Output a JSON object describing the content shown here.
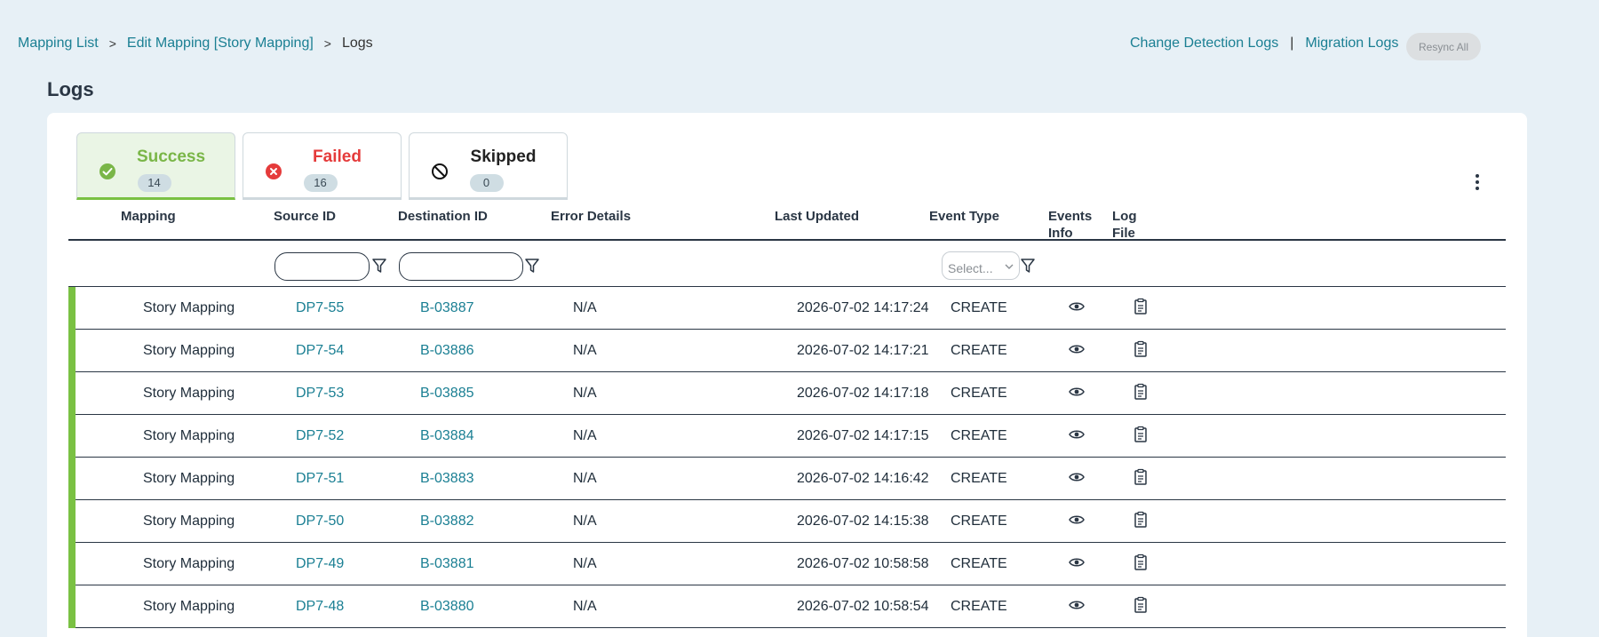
{
  "breadcrumb": {
    "items": [
      {
        "label": "Mapping List"
      },
      {
        "label": "Edit Mapping [Story Mapping]"
      },
      {
        "label": "Logs"
      }
    ],
    "separator": ">"
  },
  "toplinks": {
    "change_detection": "Change Detection Logs",
    "divider": "|",
    "migration": "Migration Logs",
    "resync": "Resync All"
  },
  "page_title": "Logs",
  "tabs": [
    {
      "label": "Success",
      "count": "14",
      "icon": "check-circle-icon",
      "color": "#7ab648"
    },
    {
      "label": "Failed",
      "count": "16",
      "icon": "x-circle-icon",
      "color": "#e53b3b"
    },
    {
      "label": "Skipped",
      "count": "0",
      "icon": "ban-icon",
      "color": "#222222"
    }
  ],
  "table": {
    "headers": {
      "mapping": "Mapping",
      "source_id": "Source ID",
      "destination_id": "Destination ID",
      "error_details": "Error Details",
      "last_updated": "Last Updated",
      "event_type": "Event Type",
      "events_info_1": "Events",
      "events_info_2": "Info",
      "log_file_1": "Log",
      "log_file_2": "File"
    },
    "filters": {
      "event_type_placeholder": "Select..."
    },
    "rows": [
      {
        "mapping": "Story Mapping",
        "source_id": "DP7-55",
        "destination_id": "B-03887",
        "error": "N/A",
        "updated": "2026-07-02 14:17:24",
        "event": "CREATE"
      },
      {
        "mapping": "Story Mapping",
        "source_id": "DP7-54",
        "destination_id": "B-03886",
        "error": "N/A",
        "updated": "2026-07-02 14:17:21",
        "event": "CREATE"
      },
      {
        "mapping": "Story Mapping",
        "source_id": "DP7-53",
        "destination_id": "B-03885",
        "error": "N/A",
        "updated": "2026-07-02 14:17:18",
        "event": "CREATE"
      },
      {
        "mapping": "Story Mapping",
        "source_id": "DP7-52",
        "destination_id": "B-03884",
        "error": "N/A",
        "updated": "2026-07-02 14:17:15",
        "event": "CREATE"
      },
      {
        "mapping": "Story Mapping",
        "source_id": "DP7-51",
        "destination_id": "B-03883",
        "error": "N/A",
        "updated": "2026-07-02 14:16:42",
        "event": "CREATE"
      },
      {
        "mapping": "Story Mapping",
        "source_id": "DP7-50",
        "destination_id": "B-03882",
        "error": "N/A",
        "updated": "2026-07-02 14:15:38",
        "event": "CREATE"
      },
      {
        "mapping": "Story Mapping",
        "source_id": "DP7-49",
        "destination_id": "B-03881",
        "error": "N/A",
        "updated": "2026-07-02 10:58:58",
        "event": "CREATE"
      },
      {
        "mapping": "Story Mapping",
        "source_id": "DP7-48",
        "destination_id": "B-03880",
        "error": "N/A",
        "updated": "2026-07-02 10:58:54",
        "event": "CREATE"
      }
    ]
  },
  "colors": {
    "link": "#1a7f93",
    "success": "#7ac143",
    "failed": "#e53b3b",
    "background": "#e7f0f6"
  }
}
